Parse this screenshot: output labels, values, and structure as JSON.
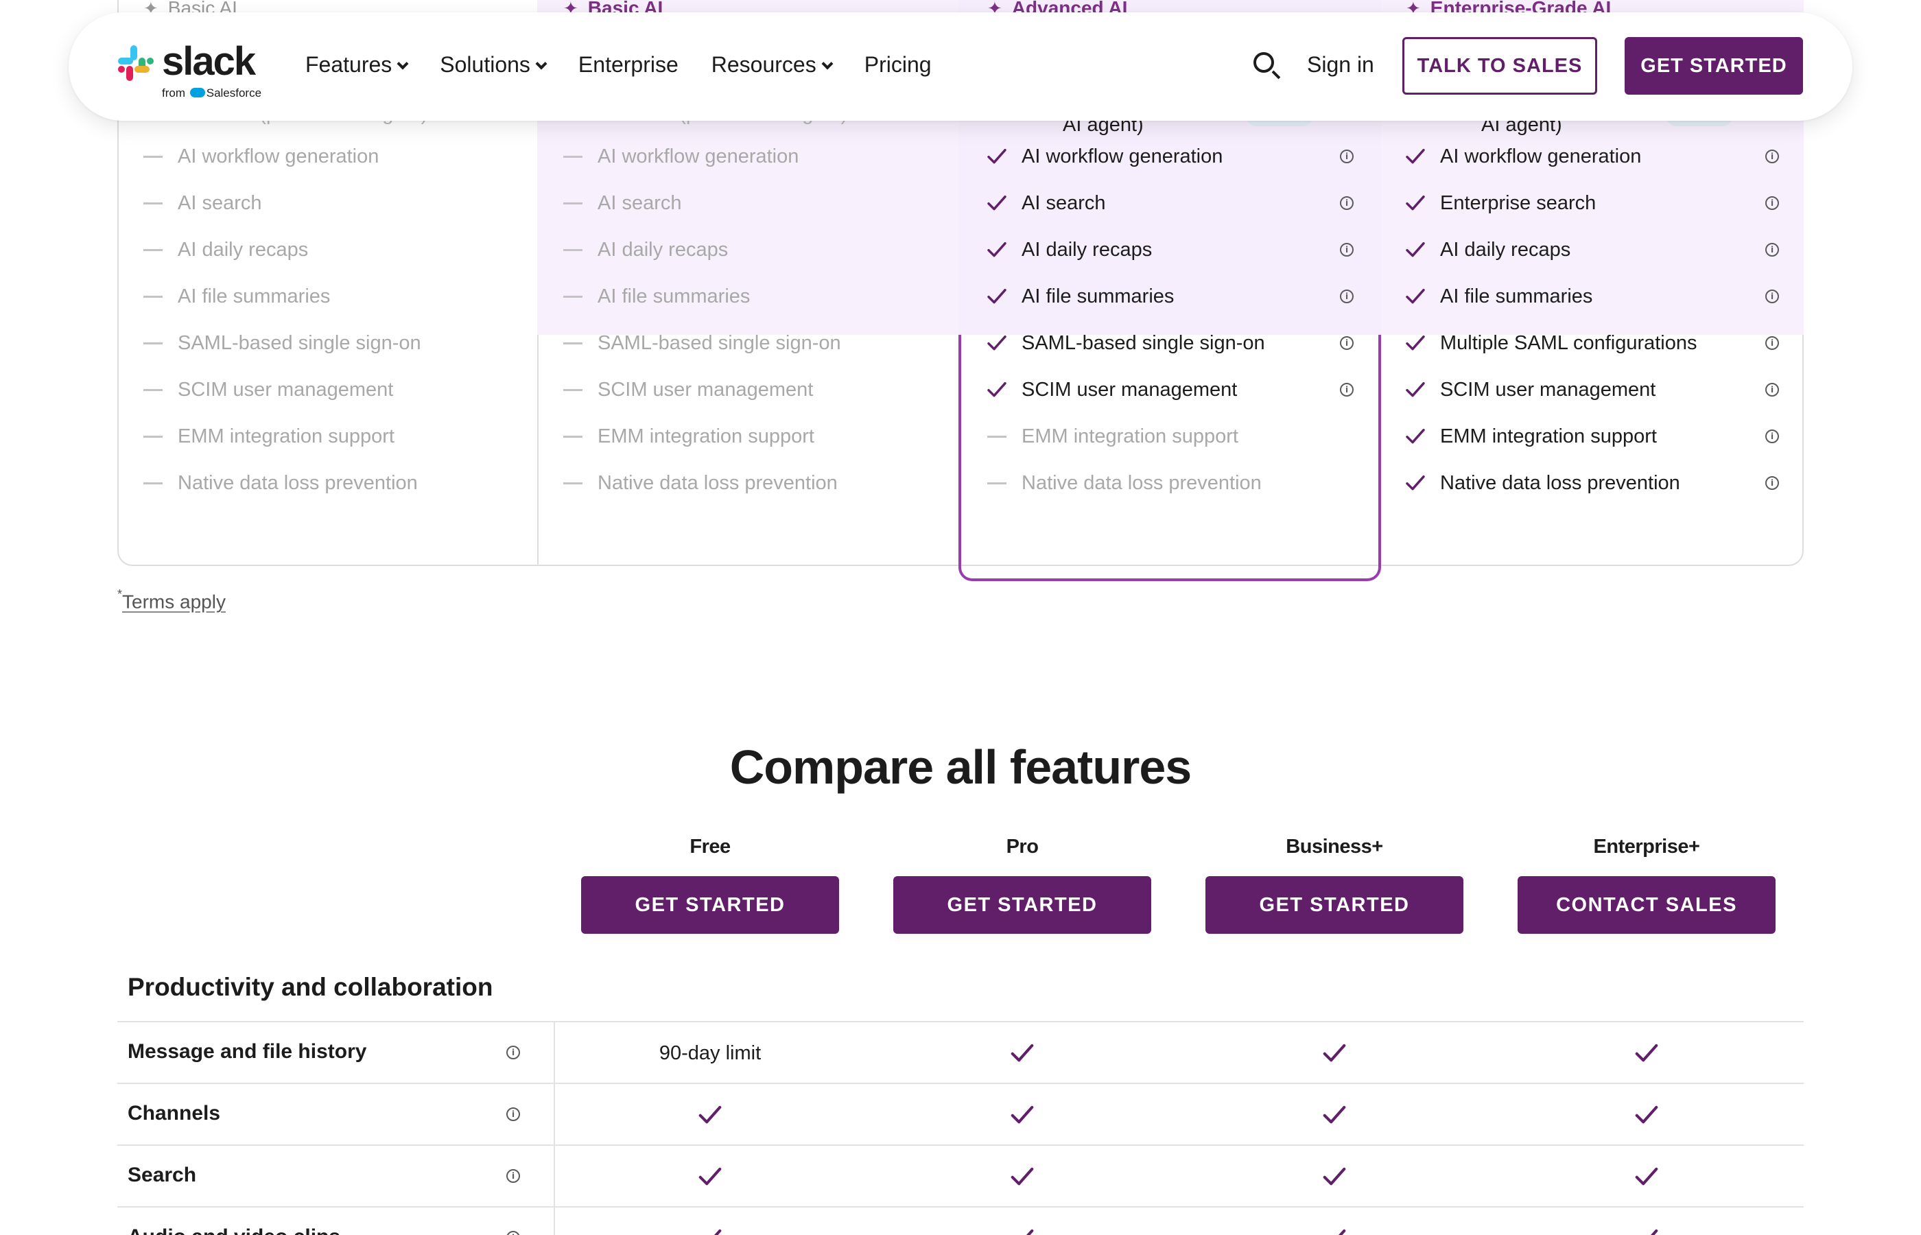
{
  "nav": {
    "logo_word": "slack",
    "logo_sub_from": "from",
    "logo_sub_brand": "Salesforce",
    "links": [
      {
        "label": "Features",
        "dropdown": true
      },
      {
        "label": "Solutions",
        "dropdown": true
      },
      {
        "label": "Enterprise",
        "dropdown": false
      },
      {
        "label": "Resources",
        "dropdown": true
      },
      {
        "label": "Pricing",
        "dropdown": false
      }
    ],
    "search_icon": "search-icon",
    "sign_in": "Sign in",
    "talk_to_sales": "TALK TO SALES",
    "get_started": "GET STARTED"
  },
  "plans": {
    "columns": [
      {
        "header": "Basic AI",
        "muted": true,
        "agent_label_prefix": "Slackbot (personal AI agent)",
        "agent_label_suffix": "",
        "agent_muted": true,
        "features": [
          {
            "label": "AI workflow generation",
            "included": false
          },
          {
            "label": "AI search",
            "included": false
          },
          {
            "label": "AI daily recaps",
            "included": false
          },
          {
            "label": "AI file summaries",
            "included": false
          },
          {
            "label": "SAML-based single sign-on",
            "included": false
          },
          {
            "label": "SCIM user management",
            "included": false
          },
          {
            "label": "EMM integration support",
            "included": false
          },
          {
            "label": "Native data loss prevention",
            "included": false
          }
        ]
      },
      {
        "header": "Basic AI",
        "muted": false,
        "agent_label_prefix": "Slackbot (personal AI agent)",
        "agent_label_suffix": "",
        "agent_muted": true,
        "features": [
          {
            "label": "AI workflow generation",
            "included": false
          },
          {
            "label": "AI search",
            "included": false
          },
          {
            "label": "AI daily recaps",
            "included": false
          },
          {
            "label": "AI file summaries",
            "included": false
          },
          {
            "label": "SAML-based single sign-on",
            "included": false
          },
          {
            "label": "SCIM user management",
            "included": false
          },
          {
            "label": "EMM integration support",
            "included": false
          },
          {
            "label": "Native data loss prevention",
            "included": false
          }
        ]
      },
      {
        "header": "Advanced AI",
        "muted": false,
        "agent_label_prefix": "",
        "agent_label_suffix": "AI agent)",
        "agent_muted": false,
        "features": [
          {
            "label": "AI workflow generation",
            "included": true
          },
          {
            "label": "AI search",
            "included": true
          },
          {
            "label": "AI daily recaps",
            "included": true
          },
          {
            "label": "AI file summaries",
            "included": true
          },
          {
            "label": "SAML-based single sign-on",
            "included": true
          },
          {
            "label": "SCIM user management",
            "included": true
          },
          {
            "label": "EMM integration support",
            "included": false
          },
          {
            "label": "Native data loss prevention",
            "included": false
          }
        ]
      },
      {
        "header": "Enterprise-Grade AI",
        "muted": false,
        "agent_label_prefix": "",
        "agent_label_suffix": "AI agent)",
        "agent_muted": false,
        "features": [
          {
            "label": "AI workflow generation",
            "included": true
          },
          {
            "label": "Enterprise search",
            "included": true
          },
          {
            "label": "AI daily recaps",
            "included": true
          },
          {
            "label": "AI file summaries",
            "included": true
          },
          {
            "label": "Multiple SAML configurations",
            "included": true
          },
          {
            "label": "SCIM user management",
            "included": true
          },
          {
            "label": "EMM integration support",
            "included": true
          },
          {
            "label": "Native data loss prevention",
            "included": true
          }
        ]
      }
    ],
    "terms_mark": "*",
    "terms_link": "Terms apply"
  },
  "compare": {
    "title": "Compare all features",
    "tiers": [
      {
        "name": "Free",
        "button": "GET STARTED"
      },
      {
        "name": "Pro",
        "button": "GET STARTED"
      },
      {
        "name": "Business+",
        "button": "GET STARTED"
      },
      {
        "name": "Enterprise+",
        "button": "CONTACT SALES"
      }
    ],
    "section": "Productivity and collaboration",
    "rows": [
      {
        "name": "Message and file history",
        "values": [
          "90-day limit",
          "check",
          "check",
          "check"
        ]
      },
      {
        "name": "Channels",
        "values": [
          "check",
          "check",
          "check",
          "check"
        ]
      },
      {
        "name": "Search",
        "values": [
          "check",
          "check",
          "check",
          "check"
        ]
      },
      {
        "name": "Audio and video clips",
        "values": [
          "check",
          "check",
          "check",
          "check"
        ]
      }
    ]
  },
  "colors": {
    "aubergine": "#611f69",
    "check": "#611f69",
    "featured_border": "#9b3bb0"
  }
}
